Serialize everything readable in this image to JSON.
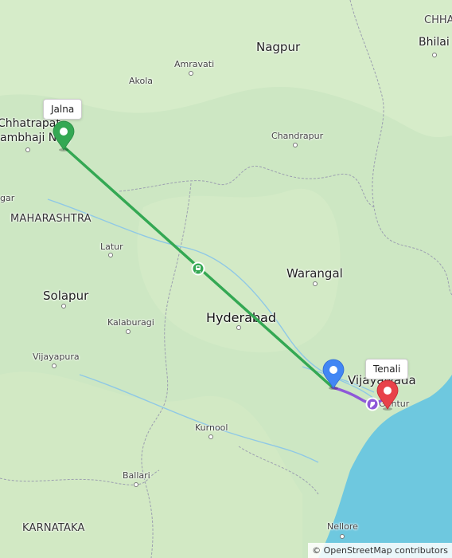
{
  "map": {
    "labels": {
      "chhattisgarh": "CHHA",
      "bhilai": "Bhilai",
      "nagpur": "Nagpur",
      "amravati": "Amravati",
      "akola": "Akola",
      "chandrapur": "Chandrapur",
      "chhatrapati_line1": "Chhatrapat",
      "chhatrapati_line2": "ambhaji Nag",
      "gar": "gar",
      "maharashtra": "MAHARASHTRA",
      "latur": "Latur",
      "warangal": "Warangal",
      "solapur": "Solapur",
      "hyderabad": "Hyderabad",
      "kalaburagi": "Kalaburagi",
      "vijayapura": "Vijayapura",
      "vijayawada": "Vijayawada",
      "guntur": "Guntur",
      "kurnool": "Kurnool",
      "ballari": "Ballari",
      "karnataka": "KARNATAKA",
      "nellore": "Nellore"
    },
    "tooltips": {
      "start": "Jalna",
      "end": "Tenali"
    },
    "route_colors": {
      "train": "#34a853",
      "local": "#8e58d8",
      "start_pin": "#34a853",
      "mid_pin": "#4286f4",
      "end_pin": "#e8424a"
    },
    "icons": {
      "train_mode": "train-icon",
      "local_mode": "local-transport-icon"
    },
    "attribution": {
      "symbol": "©",
      "link": "OpenStreetMap",
      "suffix": "contributors"
    }
  }
}
